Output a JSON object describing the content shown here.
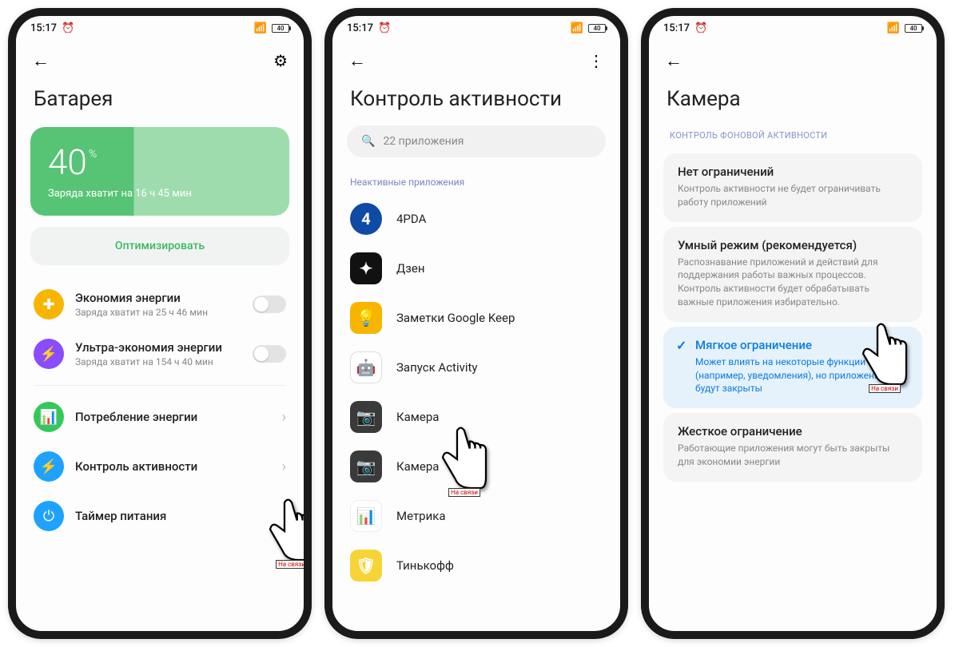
{
  "status": {
    "time": "15:17",
    "alarm": "⏰",
    "battery_pct": "40"
  },
  "screen1": {
    "title": "Батарея",
    "battery_value": "40",
    "battery_unit": "%",
    "battery_sub": "Заряда хватит на 16 ч 45 мин",
    "optimize": "Оптимизировать",
    "rows": [
      {
        "icon_bg": "#f7b500",
        "icon": "plus-box",
        "title": "Экономия энергии",
        "sub": "Заряда хватит на 25 ч 46 мин",
        "toggle": false
      },
      {
        "icon_bg": "#8a4cff",
        "icon": "bolt",
        "title": "Ультра-экономия энергии",
        "sub": "Заряда хватит на 154 ч 40 мин",
        "toggle": false
      }
    ],
    "nav": [
      {
        "icon_bg": "#34c85a",
        "icon": "bars",
        "title": "Потребление энергии"
      },
      {
        "icon_bg": "#1fa2ff",
        "icon": "bolt",
        "title": "Контроль активности"
      },
      {
        "icon_bg": "#1fa2ff",
        "icon": "power",
        "title": "Таймер питания"
      }
    ]
  },
  "screen2": {
    "title": "Контроль активности",
    "search_placeholder": "22 приложения",
    "section": "Неактивные приложения",
    "apps": [
      {
        "name": "4PDA",
        "bg": "#0f4aa5",
        "glyph": "4"
      },
      {
        "name": "Дзен",
        "bg": "#111",
        "glyph": "✦"
      },
      {
        "name": "Заметки Google Keep",
        "bg": "#f7b500",
        "glyph": "💡"
      },
      {
        "name": "Запуск Activity",
        "bg": "#fff",
        "glyph": "🤖"
      },
      {
        "name": "Камера",
        "bg": "#3a3a3a",
        "glyph": "📷"
      },
      {
        "name": "Камера",
        "bg": "#3a3a3a",
        "glyph": "📷"
      },
      {
        "name": "Метрика",
        "bg": "#fff",
        "glyph": "📊"
      },
      {
        "name": "Тинькофф",
        "bg": "#f7d436",
        "glyph": "🛡"
      }
    ]
  },
  "screen3": {
    "title": "Камера",
    "section": "КОНТРОЛЬ ФОНОВОЙ АКТИВНОСТИ",
    "options": [
      {
        "title": "Нет ограничений",
        "desc": "Контроль активности не будет ограничивать работу приложений",
        "selected": false
      },
      {
        "title": "Умный режим (рекомендуется)",
        "desc": "Распознавание приложений и действий для поддержания работы важных процессов. Контроль активности будет обрабатывать важные приложения избирательно.",
        "selected": false
      },
      {
        "title": "Мягкое ограничение",
        "desc": "Может влиять на некоторые функции (например, уведомления), но приложения не будут закрыты",
        "selected": true
      },
      {
        "title": "Жесткое ограничение",
        "desc": "Работающие приложения могут быть закрыты для экономии энергии",
        "selected": false
      }
    ]
  },
  "cursor_label": "На связи"
}
